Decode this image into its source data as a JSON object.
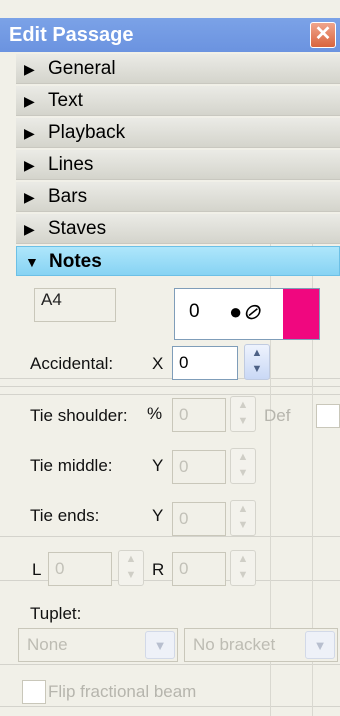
{
  "window": {
    "title": "Edit Passage",
    "close_icon": "close-icon"
  },
  "sections": [
    {
      "label": "General",
      "expanded": false
    },
    {
      "label": "Text",
      "expanded": false
    },
    {
      "label": "Playback",
      "expanded": false
    },
    {
      "label": "Lines",
      "expanded": false
    },
    {
      "label": "Bars",
      "expanded": false
    },
    {
      "label": "Staves",
      "expanded": false
    },
    {
      "label": "Notes",
      "expanded": true
    }
  ],
  "notes": {
    "pitch": "A4",
    "notehead_value": "0",
    "notehead_glyph": "●⊘",
    "color_swatch": "#f0077f",
    "accidental_label": "Accidental:",
    "accidental_axis": "X",
    "accidental_value": "0",
    "tie_shoulder_label": "Tie shoulder:",
    "tie_shoulder_unit": "%",
    "tie_shoulder_value": "0",
    "tie_shoulder_def": "Def",
    "tie_middle_label": "Tie middle:",
    "tie_middle_axis": "Y",
    "tie_middle_value": "0",
    "tie_ends_label": "Tie ends:",
    "tie_ends_axis": "Y",
    "tie_ends_value": "0",
    "l_label": "L",
    "l_value": "0",
    "r_label": "R",
    "r_value": "0",
    "tuplet_label": "Tuplet:",
    "tuplet_value": "None",
    "bracket_value": "No bracket",
    "flip_label": "Flip fractional beam"
  }
}
